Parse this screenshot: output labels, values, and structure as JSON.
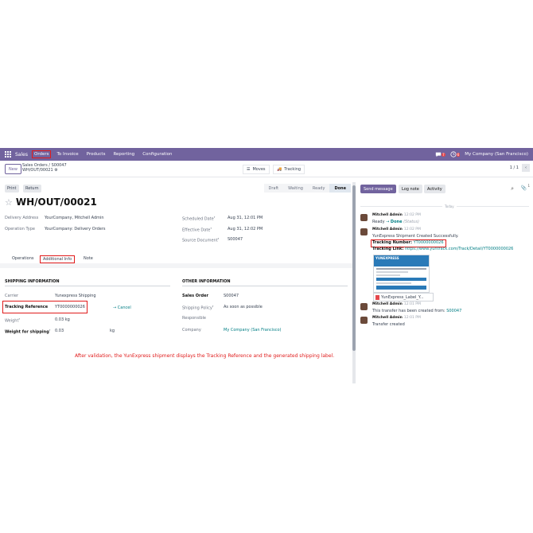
{
  "topbar": {
    "app_name": "Sales",
    "menus": [
      "Orders",
      "To Invoice",
      "Products",
      "Reporting",
      "Configuration"
    ],
    "chat_count": "7",
    "activity_count": "6",
    "company": "My Company (San Francisco)"
  },
  "control": {
    "new_label": "New",
    "breadcrumb_parent": "Sales Orders",
    "breadcrumb_parent_ref": "S00047",
    "record_name": "WH/OUT/00021",
    "moves_label": "Moves",
    "tracking_label": "Tracking",
    "pager": "1 / 1"
  },
  "header": {
    "print_label": "Print",
    "return_label": "Return",
    "statuses": [
      "Draft",
      "Waiting",
      "Ready",
      "Done"
    ],
    "current_status": "Done"
  },
  "record": {
    "title": "WH/OUT/00021",
    "delivery_address_label": "Delivery Address",
    "delivery_address": "YourCompany, Mitchell Admin",
    "operation_type_label": "Operation Type",
    "operation_type": "YourCompany: Delivery Orders",
    "scheduled_date_label": "Scheduled Date",
    "scheduled_date": "Aug 31, 12:01 PM",
    "effective_date_label": "Effective Date",
    "effective_date": "Aug 31, 12:02 PM",
    "source_document_label": "Source Document",
    "source_document": "S00047"
  },
  "tabs": [
    "Operations",
    "Additional Info",
    "Note"
  ],
  "shipping": {
    "heading": "SHIPPING INFORMATION",
    "carrier_label": "Carrier",
    "carrier": "Yunexpress Shipping",
    "tracking_label": "Tracking Reference",
    "tracking_value": "YT0000000026",
    "cancel_label": "→ Cancel",
    "weight_label": "Weight",
    "weight": "0.03 kg",
    "weight_shipping_label": "Weight for shipping",
    "weight_shipping": "0.03",
    "weight_shipping_unit": "kg"
  },
  "other": {
    "heading": "OTHER INFORMATION",
    "sales_order_label": "Sales Order",
    "sales_order": "S00047",
    "shipping_policy_label": "Shipping Policy",
    "shipping_policy": "As soon as possible",
    "responsible_label": "Responsible",
    "company_label": "Company",
    "company": "My Company (San Francisco)"
  },
  "caption": "After validation, the YunExpress shipment displays the Tracking Reference and the generated shipping label.",
  "chatter": {
    "send_message": "Send message",
    "log_note": "Log note",
    "activity": "Activity",
    "followers_count": "1",
    "date_separator": "Today",
    "messages": [
      {
        "author": "Mitchell Admin",
        "time": "12:02 PM",
        "line1_prefix": "Ready",
        "line1_arrow": "→",
        "line1_value": "Done",
        "line1_suffix": "(Status)"
      },
      {
        "author": "Mitchell Admin",
        "time": "12:02 PM",
        "text": "YunExpress Shipment Created Successfully.",
        "tracking_number_label": "Tracking Number:",
        "tracking_number": "YT0000000026",
        "tracking_link_label": "Tracking Link:",
        "tracking_link": "https://www.yuntrack.com/Track/Detail/YT0000000026",
        "attachment_name": "YunExpress_Label_Y...",
        "label_brand": "YUNEXPRESS"
      },
      {
        "author": "Mitchell Admin",
        "time": "12:01 PM",
        "text_prefix": "This transfer has been created from:",
        "text_link": "S00047"
      },
      {
        "author": "Mitchell Admin",
        "time": "12:01 PM",
        "text": "Transfer created"
      }
    ]
  }
}
